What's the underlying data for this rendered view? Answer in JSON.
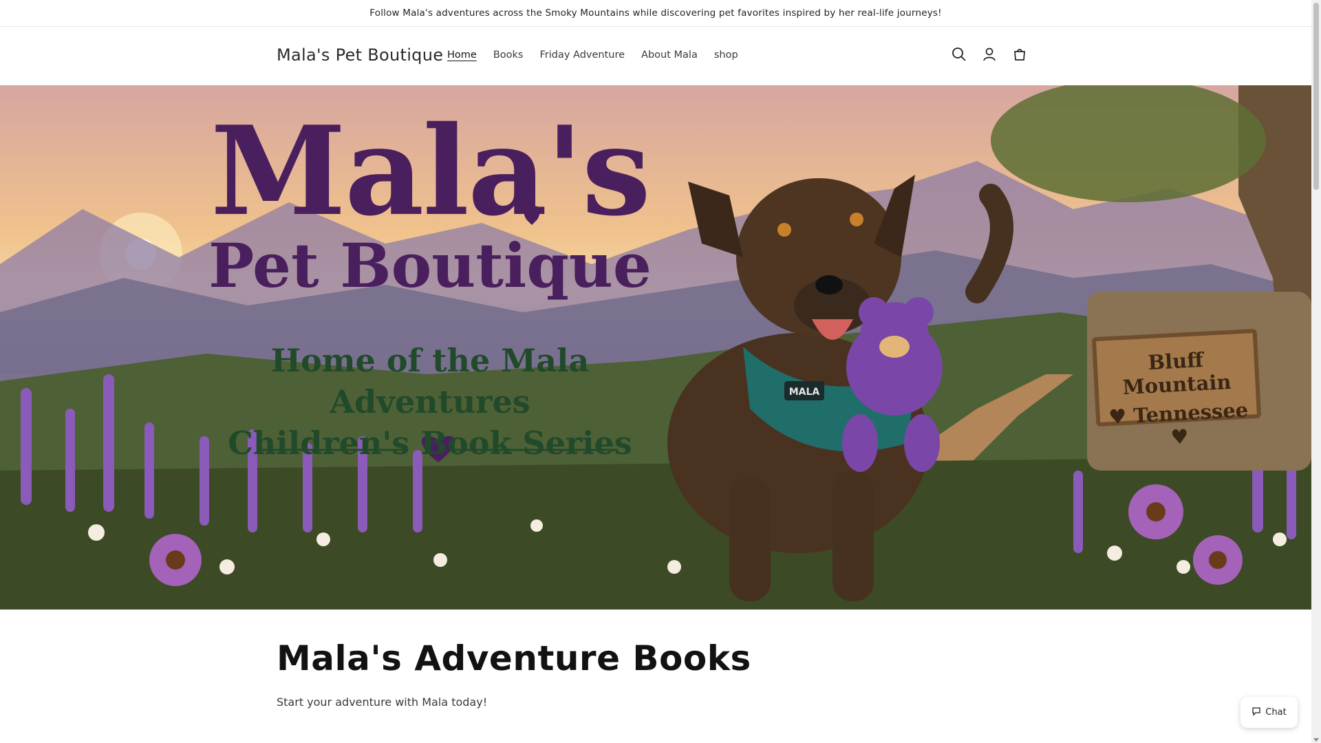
{
  "announcement": {
    "text": "Follow Mala's adventures across the Smoky Mountains while discovering pet favorites inspired by her real-life journeys!"
  },
  "header": {
    "logo": "Mala's Pet Boutique",
    "nav": [
      {
        "label": "Home",
        "active": true
      },
      {
        "label": "Books",
        "active": false
      },
      {
        "label": "Friday Adventure",
        "active": false
      },
      {
        "label": "About Mala",
        "active": false
      },
      {
        "label": "shop",
        "active": false
      }
    ],
    "icons": [
      "search-icon",
      "account-icon",
      "cart-icon"
    ]
  },
  "hero": {
    "title_line1": "Mala's",
    "title_line2": "Pet Boutique",
    "subtitle_line1": "Home of the Mala Adventures",
    "subtitle_line2": "Children's Book Series",
    "sign_line1": "Bluff Mountain",
    "sign_line2": "♥ Tennessee ♥",
    "harness_tag": "MALA",
    "colors": {
      "title": "#4a1f5e",
      "subtitle": "#214a2a"
    }
  },
  "main": {
    "section_title": "Mala's Adventure Books",
    "section_subtitle": "Start your adventure with Mala today!"
  },
  "chat": {
    "label": "Chat"
  }
}
